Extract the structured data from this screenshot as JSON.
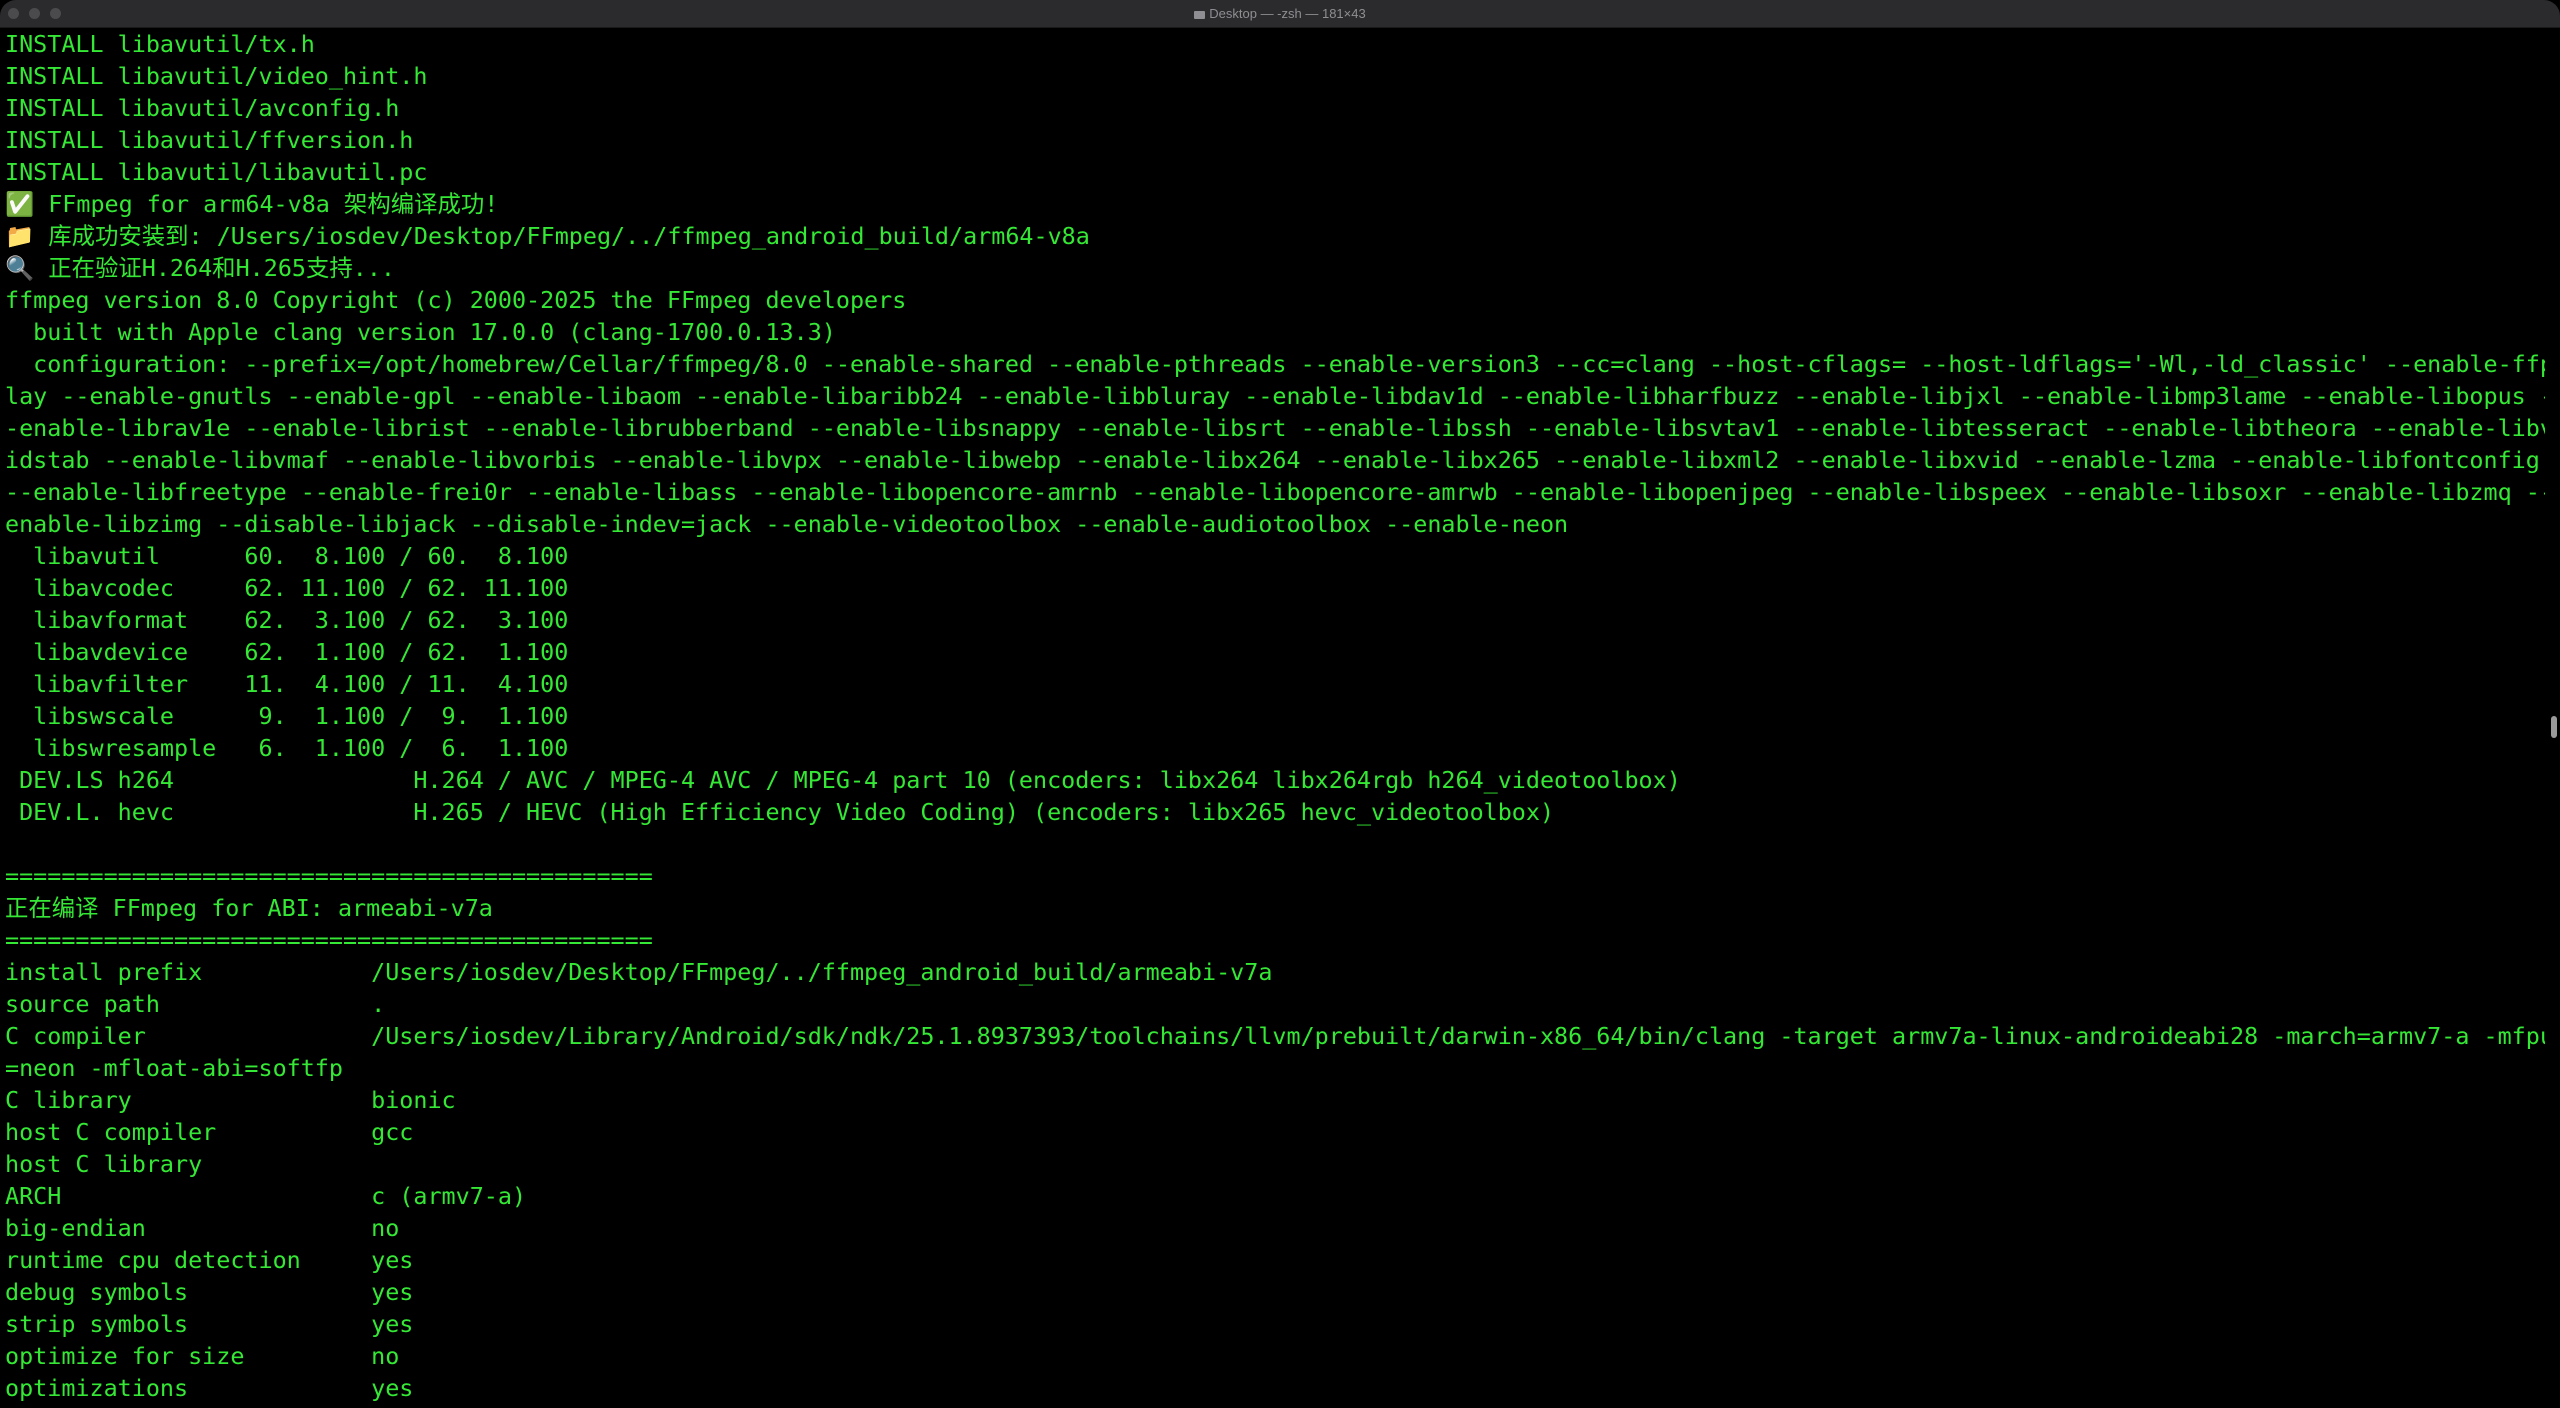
{
  "window": {
    "title": "Desktop — -zsh — 181×43"
  },
  "terminal": {
    "lines": [
      "INSTALL libavutil/tx.h",
      "INSTALL libavutil/video_hint.h",
      "INSTALL libavutil/avconfig.h",
      "INSTALL libavutil/ffversion.h",
      "INSTALL libavutil/libavutil.pc",
      "✅ FFmpeg for arm64-v8a 架构编译成功!",
      "📁 库成功安装到: /Users/iosdev/Desktop/FFmpeg/../ffmpeg_android_build/arm64-v8a",
      "🔍 正在验证H.264和H.265支持...",
      "ffmpeg version 8.0 Copyright (c) 2000-2025 the FFmpeg developers",
      "  built with Apple clang version 17.0.0 (clang-1700.0.13.3)",
      "  configuration: --prefix=/opt/homebrew/Cellar/ffmpeg/8.0 --enable-shared --enable-pthreads --enable-version3 --cc=clang --host-cflags= --host-ldflags='-Wl,-ld_classic' --enable-ffp",
      "lay --enable-gnutls --enable-gpl --enable-libaom --enable-libaribb24 --enable-libbluray --enable-libdav1d --enable-libharfbuzz --enable-libjxl --enable-libmp3lame --enable-libopus -",
      "-enable-librav1e --enable-librist --enable-librubberband --enable-libsnappy --enable-libsrt --enable-libssh --enable-libsvtav1 --enable-libtesseract --enable-libtheora --enable-libv",
      "idstab --enable-libvmaf --enable-libvorbis --enable-libvpx --enable-libwebp --enable-libx264 --enable-libx265 --enable-libxml2 --enable-libxvid --enable-lzma --enable-libfontconfig",
      "--enable-libfreetype --enable-frei0r --enable-libass --enable-libopencore-amrnb --enable-libopencore-amrwb --enable-libopenjpeg --enable-libspeex --enable-libsoxr --enable-libzmq --",
      "enable-libzimg --disable-libjack --disable-indev=jack --enable-videotoolbox --enable-audiotoolbox --enable-neon",
      "  libavutil      60.  8.100 / 60.  8.100",
      "  libavcodec     62. 11.100 / 62. 11.100",
      "  libavformat    62.  3.100 / 62.  3.100",
      "  libavdevice    62.  1.100 / 62.  1.100",
      "  libavfilter    11.  4.100 / 11.  4.100",
      "  libswscale      9.  1.100 /  9.  1.100",
      "  libswresample   6.  1.100 /  6.  1.100",
      " DEV.LS h264                 H.264 / AVC / MPEG-4 AVC / MPEG-4 part 10 (encoders: libx264 libx264rgb h264_videotoolbox)",
      " DEV.L. hevc                 H.265 / HEVC (High Efficiency Video Coding) (encoders: libx265 hevc_videotoolbox)",
      "",
      "==============================================",
      "正在编译 FFmpeg for ABI: armeabi-v7a",
      "==============================================",
      "install prefix            /Users/iosdev/Desktop/FFmpeg/../ffmpeg_android_build/armeabi-v7a",
      "source path               .",
      "C compiler                /Users/iosdev/Library/Android/sdk/ndk/25.1.8937393/toolchains/llvm/prebuilt/darwin-x86_64/bin/clang -target armv7a-linux-androideabi28 -march=armv7-a -mfpu",
      "=neon -mfloat-abi=softfp",
      "C library                 bionic",
      "host C compiler           gcc",
      "host C library",
      "ARCH                      c (armv7-a)",
      "big-endian                no",
      "runtime cpu detection     yes",
      "debug symbols             yes",
      "strip symbols             yes",
      "optimize for size         no",
      "optimizations             yes"
    ]
  },
  "colors": {
    "background": "#000000",
    "text": "#35e835",
    "titlebar": "#2b2b2d",
    "title_text": "#8e8e93"
  },
  "icons": {
    "title": "folder-icon",
    "success": "check-mark-icon",
    "install": "folder-icon",
    "verify": "magnifier-icon"
  }
}
